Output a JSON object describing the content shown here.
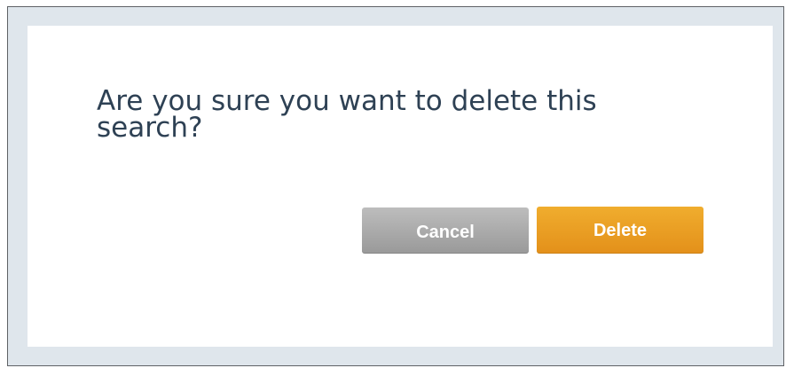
{
  "dialog": {
    "message": "Are you sure you want to delete this search?",
    "cancel_label": "Cancel",
    "delete_label": "Delete"
  },
  "colors": {
    "message_text": "#2e4154",
    "cancel_button": "#a9a9a9",
    "delete_button": "#e99f22",
    "frame_background": "#dfe6ec"
  }
}
